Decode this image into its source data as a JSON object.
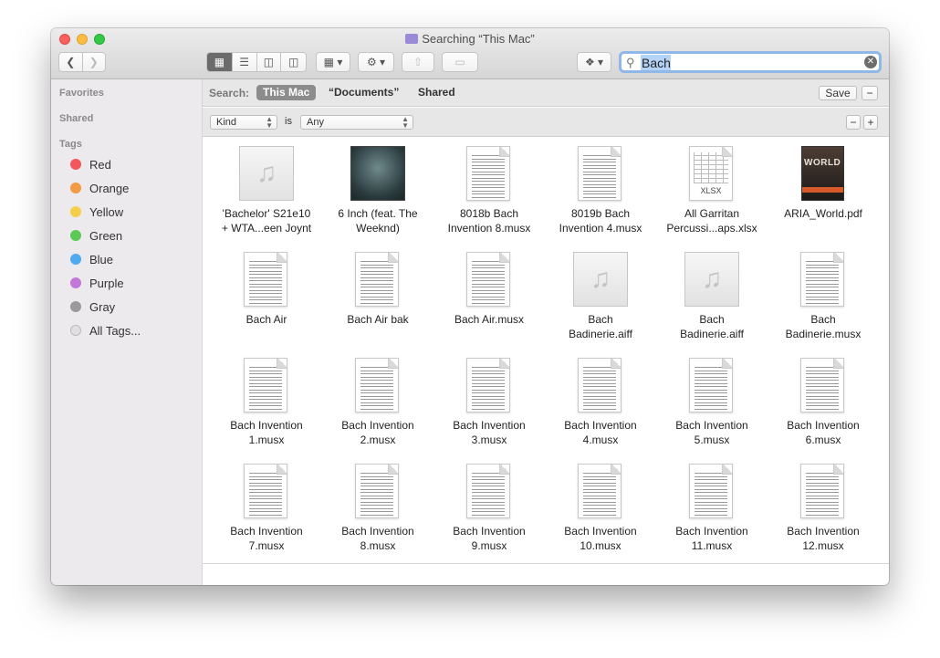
{
  "window": {
    "title": "Searching “This Mac”"
  },
  "search": {
    "value": "Bach",
    "placeholder": ""
  },
  "sidebar": {
    "favorites_label": "Favorites",
    "shared_label": "Shared",
    "tags_label": "Tags",
    "tags": [
      {
        "label": "Red",
        "color": "#f2585b"
      },
      {
        "label": "Orange",
        "color": "#f39a44"
      },
      {
        "label": "Yellow",
        "color": "#f5cf4a"
      },
      {
        "label": "Green",
        "color": "#5bc954"
      },
      {
        "label": "Blue",
        "color": "#4fa9ef"
      },
      {
        "label": "Purple",
        "color": "#c277d9"
      },
      {
        "label": "Gray",
        "color": "#9a9a9a"
      },
      {
        "label": "All Tags...",
        "color": "#e0e0e0"
      }
    ]
  },
  "scope": {
    "label": "Search:",
    "this_mac": "This Mac",
    "documents": "“Documents”",
    "shared": "Shared",
    "save": "Save",
    "remove": "−"
  },
  "criteria": {
    "attribute": "Kind",
    "operator": "is",
    "value": "Any",
    "remove": "−",
    "add": "+"
  },
  "files": [
    {
      "line1": "'Bachelor' S21e10",
      "line2": "+ WTA...een Joynt",
      "kind": "audio"
    },
    {
      "line1": "6 Inch (feat. The",
      "line2": "Weeknd)",
      "kind": "album"
    },
    {
      "line1": "8018b Bach",
      "line2": "Invention 8.musx",
      "kind": "score"
    },
    {
      "line1": "8019b Bach",
      "line2": "Invention 4.musx",
      "kind": "score"
    },
    {
      "line1": "All Garritan",
      "line2": "Percussi...aps.xlsx",
      "kind": "xlsx"
    },
    {
      "line1": "ARIA_World.pdf",
      "line2": "",
      "kind": "pdf"
    },
    {
      "line1": "Bach Air",
      "line2": "",
      "kind": "score"
    },
    {
      "line1": "Bach Air bak",
      "line2": "",
      "kind": "score"
    },
    {
      "line1": "Bach Air.musx",
      "line2": "",
      "kind": "score"
    },
    {
      "line1": "Bach",
      "line2": "Badinerie.aiff",
      "kind": "audio"
    },
    {
      "line1": "Bach",
      "line2": "Badinerie.aiff",
      "kind": "audio"
    },
    {
      "line1": "Bach",
      "line2": "Badinerie.musx",
      "kind": "score"
    },
    {
      "line1": "Bach Invention",
      "line2": "1.musx",
      "kind": "score"
    },
    {
      "line1": "Bach Invention",
      "line2": "2.musx",
      "kind": "score"
    },
    {
      "line1": "Bach Invention",
      "line2": "3.musx",
      "kind": "score"
    },
    {
      "line1": "Bach Invention",
      "line2": "4.musx",
      "kind": "score"
    },
    {
      "line1": "Bach Invention",
      "line2": "5.musx",
      "kind": "score"
    },
    {
      "line1": "Bach Invention",
      "line2": "6.musx",
      "kind": "score"
    },
    {
      "line1": "Bach Invention",
      "line2": "7.musx",
      "kind": "score"
    },
    {
      "line1": "Bach Invention",
      "line2": "8.musx",
      "kind": "score"
    },
    {
      "line1": "Bach Invention",
      "line2": "9.musx",
      "kind": "score"
    },
    {
      "line1": "Bach Invention",
      "line2": "10.musx",
      "kind": "score"
    },
    {
      "line1": "Bach Invention",
      "line2": "11.musx",
      "kind": "score"
    },
    {
      "line1": "Bach Invention",
      "line2": "12.musx",
      "kind": "score"
    }
  ],
  "icons": {
    "xlsx_label": "XLSX",
    "pdf_cover_text": "WORLD",
    "audio_glyph": "♫"
  }
}
